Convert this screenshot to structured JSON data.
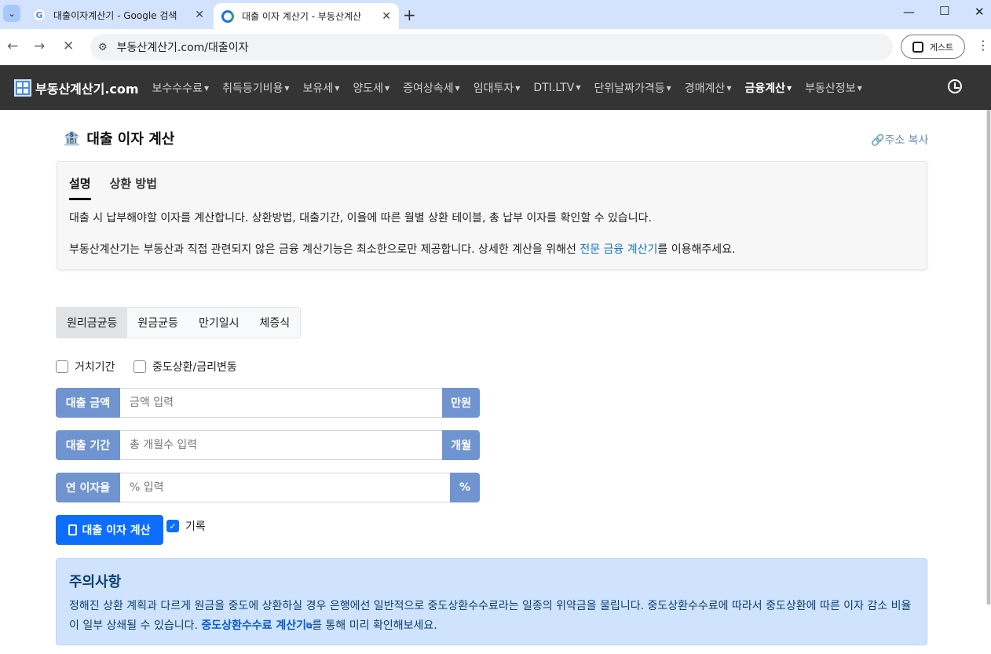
{
  "browser": {
    "tabs": [
      {
        "title": "대출이자계산기 - Google 검색",
        "active": false
      },
      {
        "title": "대출 이자 계산기 - 부동산계산",
        "active": true
      }
    ],
    "url": "부동산계산기.com/대출이자",
    "profile_label": "게스트"
  },
  "site": {
    "brand": "부동산계산기.com",
    "nav": [
      {
        "label": "보수수수료"
      },
      {
        "label": "취득등기비용"
      },
      {
        "label": "보유세"
      },
      {
        "label": "양도세"
      },
      {
        "label": "증여상속세"
      },
      {
        "label": "임대투자"
      },
      {
        "label": "DTI.LTV"
      },
      {
        "label": "단위날짜가격등"
      },
      {
        "label": "경매계산"
      },
      {
        "label": "금융계산",
        "active": true
      },
      {
        "label": "부동산정보"
      }
    ]
  },
  "page": {
    "title": "대출 이자 계산",
    "copy_link": "주소 복사",
    "desc_tabs": [
      "설명",
      "상환 방법"
    ],
    "desc_p1": "대출 시 납부해야할 이자를 계산합니다. 상환방법, 대출기간, 이율에 따른 월별 상환 테이블, 총 납부 이자를 확인할 수 있습니다.",
    "desc_p2_before": "부동산계산기는 부동산과 직접 관련되지 않은 금융 계산기능은 최소한으로만 제공합니다. 상세한 계산을 위해선 ",
    "desc_p2_link": "전문 금융 계산기",
    "desc_p2_after": "를 이용해주세요."
  },
  "form": {
    "methods": [
      "원리금균등",
      "원금균등",
      "만기일시",
      "체증식"
    ],
    "selected_method": "원리금균등",
    "grace_label": "거치기간",
    "prepay_label": "중도상환/금리변동",
    "amount": {
      "label": "대출 금액",
      "placeholder": "금액 입력",
      "unit": "만원"
    },
    "period": {
      "label": "대출 기간",
      "placeholder": "총 개월수 입력",
      "unit": "개월"
    },
    "rate": {
      "label": "연 이자율",
      "placeholder": "% 입력",
      "unit": "%"
    },
    "submit_label": "대출 이자 계산",
    "record_label": "기록",
    "record_checked": true
  },
  "notice": {
    "title": "주의사항",
    "body_before": "정해진 상환 계획과 다르게 원금을 중도에 상환하실 경우 은행에선 일반적으로 중도상환수수료라는 일종의 위약금을 물립니다. 중도상환수수료에 따라서 중도상환에 따른 이자 감소 비율이 일부 상쇄될 수 있습니다. ",
    "body_link": "중도상환수수료 계산기",
    "body_after": "를 통해 미리 확인해보세요."
  }
}
